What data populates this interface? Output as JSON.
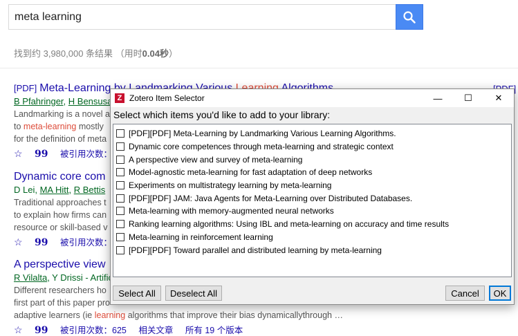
{
  "search": {
    "query": "meta learning"
  },
  "stats": {
    "prefix": "找到约 3,980,000 条结果 （用时",
    "time": "0.04秒",
    "suffix": "）"
  },
  "results": [
    {
      "pdf_tag": "[PDF]",
      "title_a": "Meta-Learning by Landmarking Various ",
      "title_hl": "Learning",
      "title_b": " Algorithms",
      "authors_a": "B Pfahringer",
      "authors_sep": ", ",
      "authors_b": "H Bensusan",
      "snippet1": "Landmarking is a novel a",
      "snippet2_hl": "meta-learning",
      "snippet2_pre": "to ",
      "snippet2_post": " mostly",
      "snippet3": "for the definition of meta",
      "cited": "被引用次数：",
      "side_pdf": "[PDF]"
    },
    {
      "title": "Dynamic core com",
      "authors_a": "D Lei",
      "authors_b": "MA Hitt",
      "authors_c": "R Bettis",
      "snippet1": "Traditional approaches t",
      "snippet2": "to explain how firms can",
      "snippet3": "resource or skill-based v",
      "cited": "被引用次数："
    },
    {
      "title": "A perspective view",
      "authors_a": "R Vilalta",
      "authors_b": ", Y Drissi - Artific",
      "snippet1": "Different researchers ho",
      "snippet2": "first part of this paper pro",
      "snippet3_pre": "adaptive learners (ie ",
      "snippet3_hl": "learning",
      "snippet3_post": " algorithms that improve their bias dynamicallythrough …",
      "cited": "被引用次数：625",
      "related": "相关文章",
      "versions": "所有 19 个版本",
      "side_pdf": "["
    }
  ],
  "dialog": {
    "title": "Zotero Item Selector",
    "minimize": "—",
    "maximize": "☐",
    "close": "✕",
    "prompt": "Select which items you'd like to add to your library:",
    "items": [
      "[PDF][PDF] Meta-Learning by Landmarking Various Learning Algorithms.",
      "Dynamic core competences through meta-learning and strategic context",
      "A perspective view and survey of meta-learning",
      "Model-agnostic meta-learning for fast adaptation of deep networks",
      "Experiments on multistrategy learning by meta-learning",
      "[PDF][PDF] JAM: Java Agents for Meta-Learning over Distributed Databases.",
      "Meta-learning with memory-augmented neural networks",
      "Ranking learning algorithms: Using IBL and meta-learning on accuracy and time results",
      "Meta-learning in reinforcement learning",
      "[PDF][PDF] Toward parallel and distributed learning by meta-learning"
    ],
    "select_all": "Select All",
    "deselect_all": "Deselect All",
    "cancel": "Cancel",
    "ok": "OK"
  },
  "icons": {
    "star": "☆",
    "quote": "99"
  },
  "colors": {
    "link": "#1a0dab",
    "author": "#006621",
    "highlight": "#dd4b39",
    "search_button": "#4a8af4",
    "zotero_red": "#c8102e"
  }
}
